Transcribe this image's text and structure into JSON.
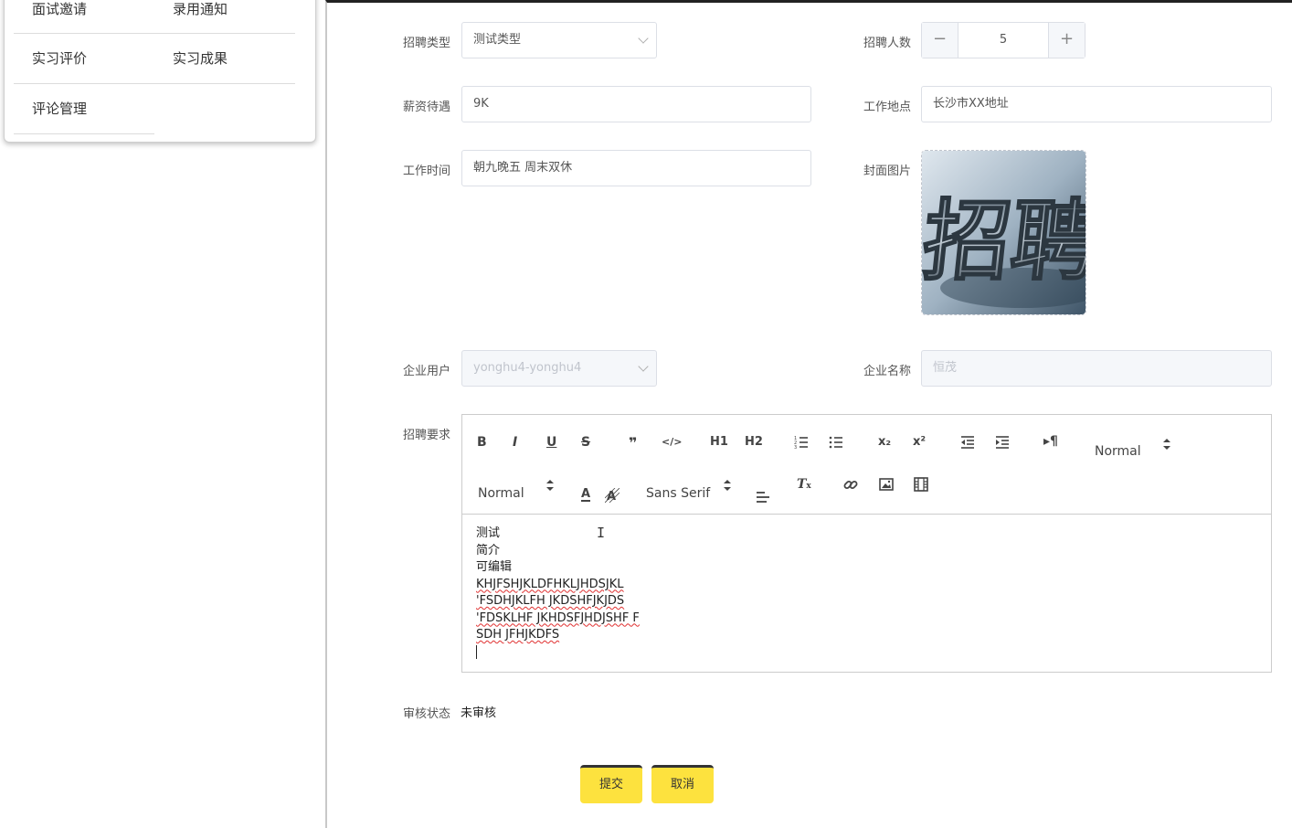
{
  "menu": {
    "items": [
      {
        "label": "面试邀请"
      },
      {
        "label": "录用通知"
      },
      {
        "label": "实习评价"
      },
      {
        "label": "实习成果"
      },
      {
        "label": "评论管理"
      }
    ]
  },
  "form": {
    "recruit_type": {
      "label": "招聘类型",
      "value": "测试类型"
    },
    "recruit_count": {
      "label": "招聘人数",
      "value": "5",
      "minus": "−",
      "plus": "+"
    },
    "salary": {
      "label": "薪资待遇",
      "value": "9K"
    },
    "location": {
      "label": "工作地点",
      "value": "长沙市XX地址"
    },
    "work_time": {
      "label": "工作时间",
      "value": "朝九晚五 周末双休"
    },
    "cover": {
      "label": "封面图片",
      "image_text": "招聘"
    },
    "company_user": {
      "label": "企业用户",
      "value": "yonghu4-yonghu4"
    },
    "company_name": {
      "label": "企业名称",
      "value": "恒茂"
    },
    "requirements": {
      "label": "招聘要求",
      "toolbar": {
        "bold": "B",
        "italic": "I",
        "underline": "U",
        "strike": "S",
        "quote": "❞",
        "code": "</>",
        "h1": "H1",
        "h2": "H2",
        "sub": "x₂",
        "sup": "x²",
        "rtl": "¶",
        "header_select": "Normal",
        "size_select": "Normal",
        "font_select": "Sans Serif",
        "color": "A",
        "clean": "T"
      },
      "lines": [
        "测试",
        "简介",
        "可编辑",
        "KHJFSHJKLDFHKLJHDSJKL",
        "'FSDHJKLFH JKDSHFJKJDS",
        "'FDSKLHF JKHDSFJHDJSHF F",
        "SDH JFHJKDFS"
      ]
    },
    "audit": {
      "label": "审核状态",
      "value": "未审核"
    }
  },
  "actions": {
    "submit": "提交",
    "cancel": "取消"
  },
  "colors": {
    "button": "#fde23e",
    "spell_error": "#e03030"
  }
}
